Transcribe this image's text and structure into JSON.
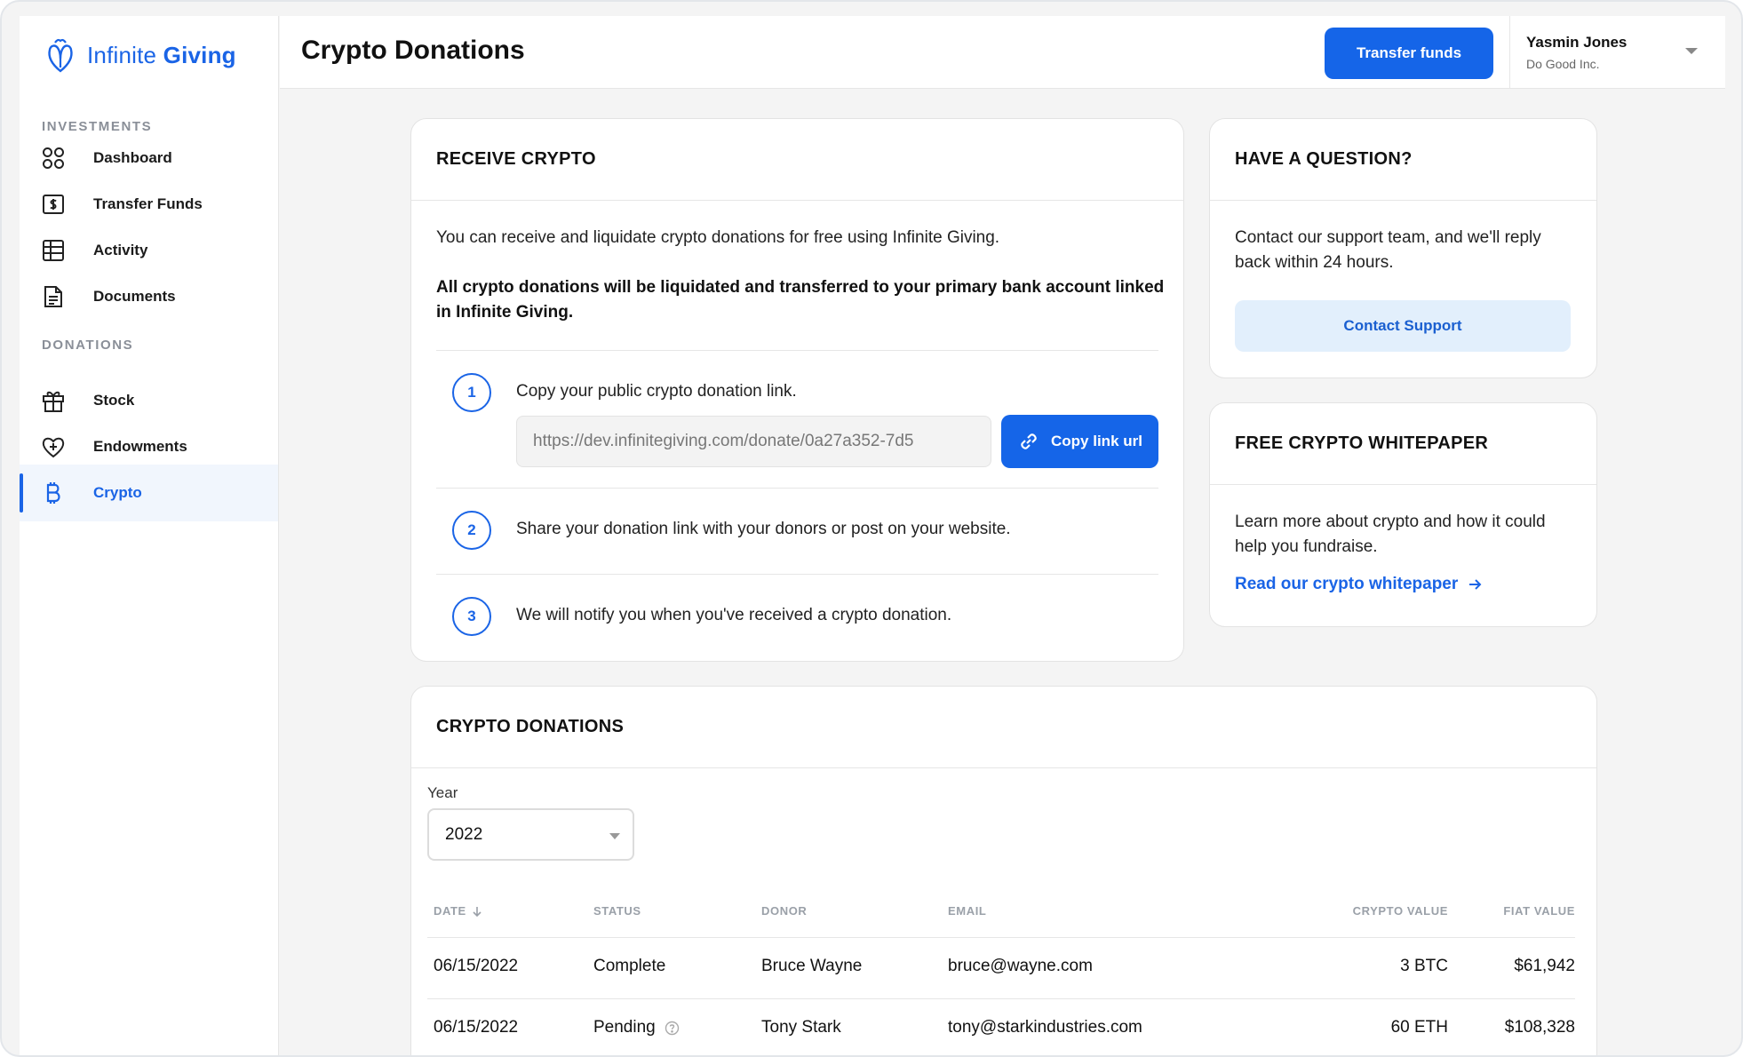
{
  "brand": {
    "name_light": "Infinite",
    "name_bold": "Giving",
    "accent": "#1a64e6"
  },
  "sidebar": {
    "sections": [
      {
        "label": "INVESTMENTS",
        "items": [
          {
            "label": "Dashboard",
            "icon": "dashboard-icon"
          },
          {
            "label": "Transfer Funds",
            "icon": "transfer-icon"
          },
          {
            "label": "Activity",
            "icon": "table-icon"
          },
          {
            "label": "Documents",
            "icon": "document-icon"
          }
        ]
      },
      {
        "label": "DONATIONS",
        "items": [
          {
            "label": "Stock",
            "icon": "gift-icon"
          },
          {
            "label": "Endowments",
            "icon": "heart-plus-icon"
          },
          {
            "label": "Crypto",
            "icon": "bitcoin-icon",
            "active": true
          }
        ]
      }
    ]
  },
  "header": {
    "title": "Crypto Donations",
    "transfer_button": "Transfer funds",
    "user": {
      "name": "Yasmin Jones",
      "org": "Do Good Inc."
    }
  },
  "receive": {
    "title": "RECEIVE CRYPTO",
    "intro": "You can receive and liquidate crypto donations for free using Infinite Giving.",
    "notice": "All crypto donations will be liquidated and transferred to your primary bank account linked in Infinite Giving.",
    "steps": [
      {
        "num": "1",
        "text": "Copy your public crypto donation link."
      },
      {
        "num": "2",
        "text": "Share your donation link with your donors or post on your website."
      },
      {
        "num": "3",
        "text": "We will notify you when you've received a crypto donation."
      }
    ],
    "link_value": "https://dev.infinitegiving.com/donate/0a27a352-7d5",
    "copy_button": "Copy link url"
  },
  "question": {
    "title": "HAVE A QUESTION?",
    "text": "Contact our support team, and we'll reply back within 24 hours.",
    "button": "Contact Support"
  },
  "whitepaper": {
    "title": "FREE CRYPTO WHITEPAPER",
    "text": "Learn more about crypto and how it could help you fundraise.",
    "link": "Read our crypto whitepaper"
  },
  "donations": {
    "title": "CRYPTO DONATIONS",
    "year_label": "Year",
    "year_value": "2022",
    "columns": [
      "DATE",
      "STATUS",
      "DONOR",
      "EMAIL",
      "CRYPTO VALUE",
      "FIAT VALUE"
    ],
    "rows": [
      {
        "date": "06/15/2022",
        "status": "Complete",
        "donor": "Bruce Wayne",
        "email": "bruce@wayne.com",
        "crypto": "3 BTC",
        "fiat": "$61,942"
      },
      {
        "date": "06/15/2022",
        "status": "Pending",
        "donor": "Tony Stark",
        "email": "tony@starkindustries.com",
        "crypto": "60 ETH",
        "fiat": "$108,328"
      }
    ]
  }
}
